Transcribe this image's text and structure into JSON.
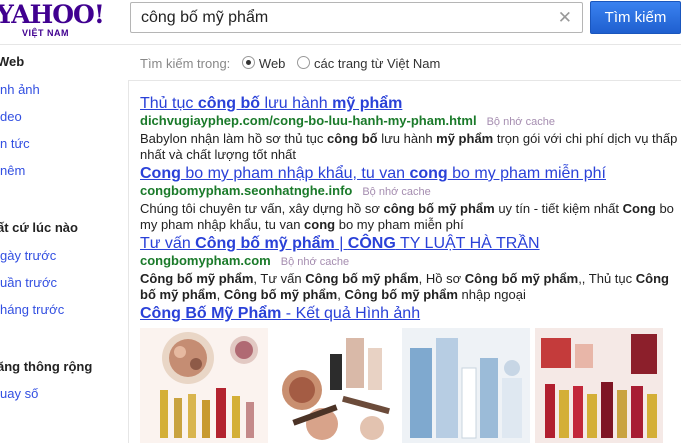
{
  "logo": {
    "word": "YAHOO!",
    "sub": "VIỆT NAM"
  },
  "search": {
    "value": "công bố mỹ phẩm",
    "button": "Tìm kiếm"
  },
  "sidebar": {
    "web_label": "Web",
    "items": [
      "nh ảnh",
      "deo",
      "n tức",
      "nêm"
    ],
    "time_label": "ất cứ lúc nào",
    "time_items": [
      "gày trước",
      "uần trước",
      "háng trước"
    ],
    "ext_label": "ăng thông rộng",
    "ext_items": [
      "uay số"
    ]
  },
  "filters": {
    "label": "Tìm kiếm trong:",
    "web": "Web",
    "vn": "các trang từ Việt Nam"
  },
  "results": [
    {
      "title": [
        "Thủ tục ",
        "công bố",
        " lưu hành ",
        "mỹ phẩm",
        ""
      ],
      "url": "dichvugiayphep.com/cong-bo-luu-hanh-my-pham.html",
      "cache": "Bộ nhớ cache",
      "snippet": [
        "Babylon nhận làm hồ sơ thủ tục ",
        "công bố",
        " lưu hành ",
        "mỹ phẩm",
        " trọn gói với chi phí dịch vụ thấp nhất và chất lượng tốt nhất"
      ]
    },
    {
      "title": [
        "",
        "Cong",
        " bo my pham nhập khẩu, tu van ",
        "cong",
        " bo my pham miễn phí"
      ],
      "url": "congbomypham.seonhatnghe.info",
      "cache": "Bộ nhớ cache",
      "snippet": [
        "Chúng tôi chuyên tư vấn, xây dựng hồ sơ ",
        "công bố",
        " ",
        "mỹ phẩm",
        " uy tín - tiết kiệm nhất ",
        "Cong",
        " bo my pham nhập khẩu, tu van ",
        "cong",
        " bo my pham miễn phí"
      ]
    },
    {
      "title": [
        "Tư vấn ",
        "Công bố",
        " ",
        "mỹ phẩm",
        " | ",
        "CÔNG",
        " TY LUẬT HÀ TRẦN"
      ],
      "url": "congbomypham.com",
      "cache": "Bộ nhớ cache",
      "snippet": [
        "",
        "Công bố",
        " ",
        "mỹ phẩm",
        ", Tư vấn ",
        "Công bố",
        " ",
        "mỹ phẩm",
        ", Hồ sơ ",
        "Công bố",
        " ",
        "mỹ phẩm",
        ",, Thủ tục ",
        "Công bố",
        " ",
        "mỹ phẩm",
        ", ",
        "Công bố",
        " ",
        "mỹ phẩm",
        ", ",
        "Công bố",
        " ",
        "mỹ phẩm",
        " nhập ngoại"
      ]
    }
  ],
  "images": {
    "title_bold": "Công Bố Mỹ Phẩm",
    "title_rest": " - Kết quả Hình ảnh"
  }
}
